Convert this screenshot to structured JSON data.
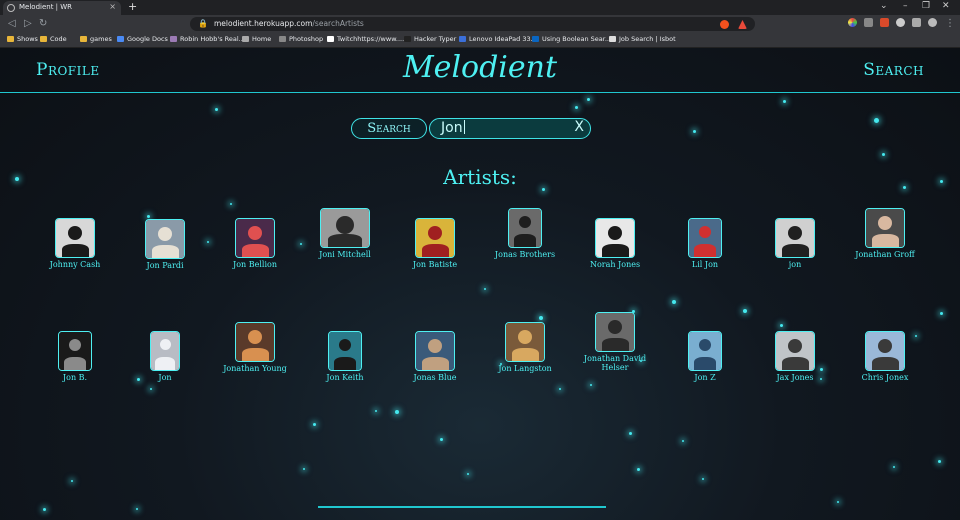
{
  "browser": {
    "tab_title": "Melodient | WR",
    "tab_close": "×",
    "new_tab": "+",
    "window_controls": [
      "⌄",
      "–",
      "❐",
      "✕"
    ],
    "url_host": "melodient.herokuapp.com",
    "url_path": "/searchArtists",
    "bookmarks": [
      {
        "label": "Shows",
        "color": "#e8b63a"
      },
      {
        "label": "Code",
        "color": "#e8b63a"
      },
      {
        "label": "games",
        "color": "#e8b63a"
      },
      {
        "label": "Google Docs",
        "color": "#4a8af4"
      },
      {
        "label": "Robin Hobb's Real...",
        "color": "#9c7bb5"
      },
      {
        "label": "Home",
        "color": "#aaaaaa"
      },
      {
        "label": "Photoshop",
        "color": "#888888"
      },
      {
        "label": "Twitchhttps://www....",
        "color": "#ffffff"
      },
      {
        "label": "Hacker Typer",
        "color": "#222222"
      },
      {
        "label": "Lenovo IdeaPad 33...",
        "color": "#3b6fd9"
      },
      {
        "label": "Using Boolean Sear...",
        "color": "#0a66c2"
      },
      {
        "label": "Job Search | Isbot",
        "color": "#dddddd"
      }
    ]
  },
  "header": {
    "profile_label": "Profile",
    "logo": "Melodient",
    "search_label": "Search"
  },
  "search": {
    "button_label": "Search",
    "value": "Jon",
    "clear_label": "X"
  },
  "artists_heading": "Artists:",
  "artists": [
    {
      "name": "Johnny Cash",
      "bg": "#d8d8d8",
      "fg": "#1a1a1a"
    },
    {
      "name": "Jon Pardi",
      "bg": "#8a9aa8",
      "fg": "#e6e0d4"
    },
    {
      "name": "Jon Bellion",
      "bg": "#4a2a4a",
      "fg": "#e05050"
    },
    {
      "name": "Joni Mitchell",
      "bg": "#9a9a9a",
      "fg": "#2a2a2a"
    },
    {
      "name": "Jon Batiste",
      "bg": "#d9b43a",
      "fg": "#a02020"
    },
    {
      "name": "Jonas Brothers",
      "bg": "#6a6a6a",
      "fg": "#1e1e1e"
    },
    {
      "name": "Norah Jones",
      "bg": "#e8e8e8",
      "fg": "#1a1a1a"
    },
    {
      "name": "Lil Jon",
      "bg": "#4a6a8a",
      "fg": "#d03030"
    },
    {
      "name": "jon",
      "bg": "#d0d0d0",
      "fg": "#202020"
    },
    {
      "name": "Jonathan Groff",
      "bg": "#4a4a4a",
      "fg": "#d8b8a0"
    },
    {
      "name": "Jon B.",
      "bg": "#1a1a1a",
      "fg": "#8a8a8a"
    },
    {
      "name": "Jon",
      "bg": "#b8bcc4",
      "fg": "#eef0f4"
    },
    {
      "name": "Jonathan Young",
      "bg": "#5a3a2a",
      "fg": "#d89050"
    },
    {
      "name": "Jon Keith",
      "bg": "#2a7a8a",
      "fg": "#1a1a1a"
    },
    {
      "name": "Jonas Blue",
      "bg": "#3a5a7a",
      "fg": "#c0a080"
    },
    {
      "name": "Jon Langston",
      "bg": "#7a5a3a",
      "fg": "#d8a860"
    },
    {
      "name": "Jonathan David Helser",
      "bg": "#6a6a6a",
      "fg": "#2a2a2a"
    },
    {
      "name": "Jon Z",
      "bg": "#7aaed0",
      "fg": "#2a4a6a"
    },
    {
      "name": "Jax Jones",
      "bg": "#c0c4c8",
      "fg": "#3a3a3a"
    },
    {
      "name": "Chris Jonex",
      "bg": "#9ab8d8",
      "fg": "#3a3a3a"
    }
  ]
}
